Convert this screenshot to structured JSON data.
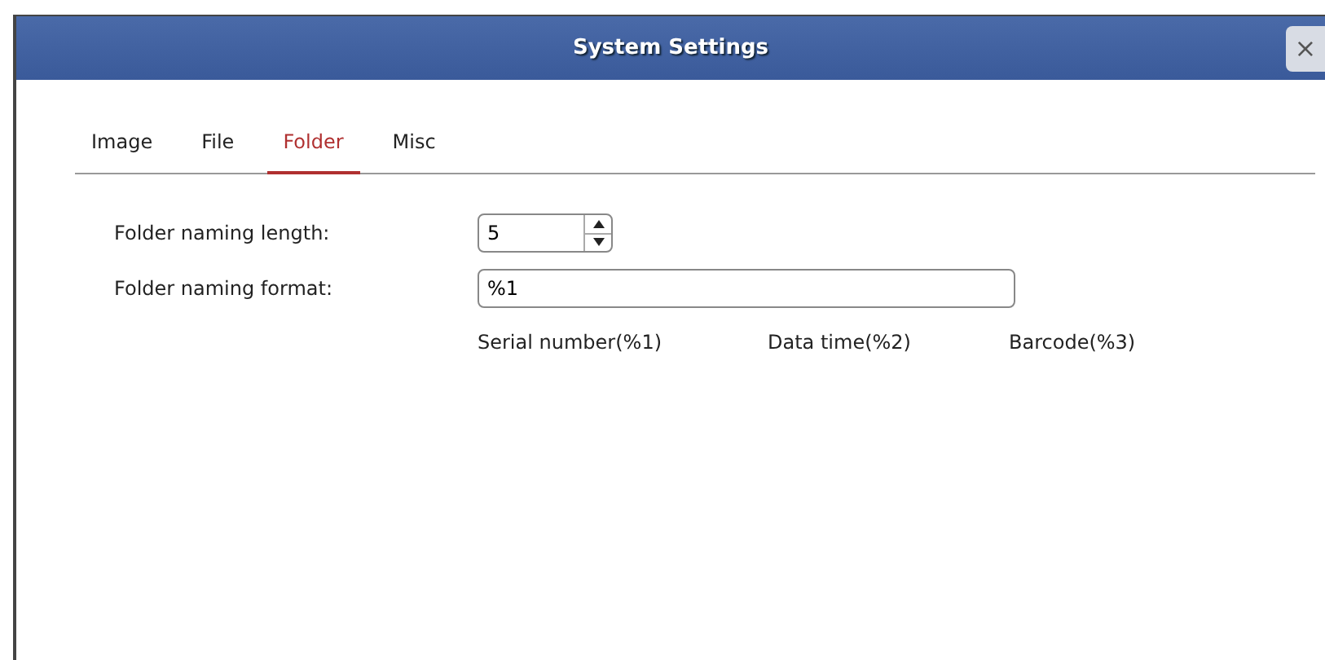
{
  "window": {
    "title": "System Settings",
    "close": "×"
  },
  "tabs": [
    {
      "label": "Image",
      "selected": false
    },
    {
      "label": "File",
      "selected": false
    },
    {
      "label": "Folder",
      "selected": true
    },
    {
      "label": "Misc",
      "selected": false
    }
  ],
  "fields": [
    {
      "label": "Folder naming length:",
      "kind": "spinner",
      "value": "5"
    },
    {
      "label": "Folder naming format:",
      "kind": "text",
      "value": "%1"
    }
  ],
  "hints": [
    "Serial number(%1)",
    "Data time(%2)",
    "Barcode(%3)"
  ]
}
